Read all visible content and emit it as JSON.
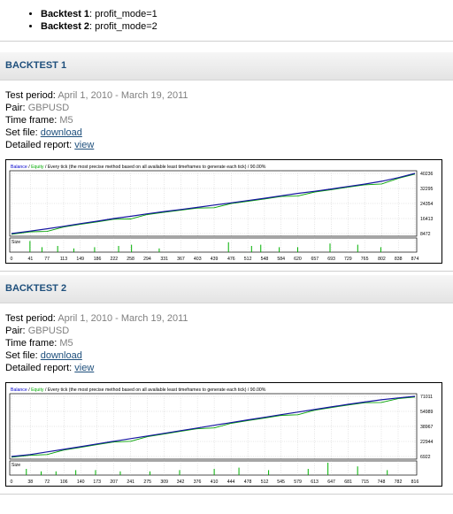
{
  "intro": {
    "items": [
      {
        "label": "Backtest 1",
        "value": "profit_mode=1"
      },
      {
        "label": "Backtest 2",
        "value": "profit_mode=2"
      }
    ]
  },
  "backtests": [
    {
      "title": "BACKTEST 1",
      "test_period_label": "Test period:",
      "test_period": "April 1, 2010 - March 19, 2011",
      "pair_label": "Pair:",
      "pair": "GBPUSD",
      "timeframe_label": "Time frame:",
      "timeframe": "M5",
      "setfile_label": "Set file:",
      "setfile_link": "download",
      "report_label": "Detailed report:",
      "report_link": "view",
      "chart_data": {
        "type": "line",
        "legend": [
          "Balance",
          "Equity"
        ],
        "header_text": "Every tick (the most precise method based on all available least timeframes to generate each tick) / 90.00%",
        "y_ticks": [
          40236,
          32295,
          24354,
          16413,
          8472
        ],
        "x_ticks": [
          0,
          41,
          77,
          113,
          149,
          186,
          222,
          258,
          294,
          331,
          367,
          403,
          439,
          476,
          512,
          548,
          584,
          620,
          657,
          693,
          729,
          765,
          802,
          838,
          874
        ],
        "x": [
          0,
          41,
          77,
          113,
          149,
          186,
          222,
          258,
          294,
          331,
          367,
          403,
          439,
          476,
          512,
          548,
          584,
          620,
          657,
          693,
          729,
          765,
          802,
          838,
          874
        ],
        "balance": [
          8472,
          9800,
          11000,
          12300,
          13700,
          15000,
          16400,
          17600,
          18900,
          20100,
          21200,
          22300,
          23500,
          24700,
          25900,
          27100,
          28400,
          29700,
          30800,
          32000,
          33300,
          34600,
          36100,
          38000,
          40236
        ],
        "size_label": "Size",
        "size_bars_x": [
          40,
          66,
          100,
          135,
          180,
          232,
          260,
          320,
          470,
          520,
          540,
          580,
          620,
          690,
          750,
          800
        ],
        "size_bars_h": [
          0.9,
          0.4,
          0.5,
          0.3,
          0.4,
          0.5,
          0.6,
          0.3,
          0.8,
          0.5,
          0.6,
          0.4,
          0.4,
          0.7,
          0.6,
          0.4
        ]
      }
    },
    {
      "title": "BACKTEST 2",
      "test_period_label": "Test period:",
      "test_period": "April 1, 2010 - March 19, 2011",
      "pair_label": "Pair:",
      "pair": "GBPUSD",
      "timeframe_label": "Time frame:",
      "timeframe": "M5",
      "setfile_label": "Set file:",
      "setfile_link": "download",
      "report_label": "Detailed report:",
      "report_link": "view",
      "chart_data": {
        "type": "line",
        "legend": [
          "Balance",
          "Equity"
        ],
        "header_text": "Every tick (the most precise method based on all available least timeframes to generate each tick) / 90.00%",
        "y_ticks": [
          71011,
          54989,
          38967,
          22944,
          6922
        ],
        "x_ticks": [
          0,
          38,
          72,
          106,
          140,
          173,
          207,
          241,
          275,
          309,
          342,
          376,
          410,
          444,
          478,
          512,
          545,
          579,
          613,
          647,
          681,
          715,
          748,
          782,
          816
        ],
        "x": [
          0,
          38,
          72,
          106,
          140,
          173,
          207,
          241,
          275,
          309,
          342,
          376,
          410,
          444,
          478,
          512,
          545,
          579,
          613,
          647,
          681,
          715,
          748,
          782,
          816
        ],
        "balance": [
          6922,
          9000,
          11800,
          14600,
          17400,
          20300,
          23100,
          26000,
          28800,
          31600,
          34400,
          37300,
          40200,
          43000,
          45900,
          48700,
          51500,
          54200,
          57000,
          59800,
          62500,
          65000,
          67300,
          69300,
          71011
        ],
        "size_label": "Size",
        "size_bars_x": [
          30,
          60,
          90,
          130,
          170,
          220,
          280,
          340,
          410,
          460,
          520,
          600,
          640,
          700,
          760
        ],
        "size_bars_h": [
          0.5,
          0.3,
          0.3,
          0.4,
          0.4,
          0.3,
          0.3,
          0.4,
          0.5,
          0.6,
          0.4,
          0.5,
          1.0,
          0.7,
          0.4
        ]
      }
    }
  ]
}
